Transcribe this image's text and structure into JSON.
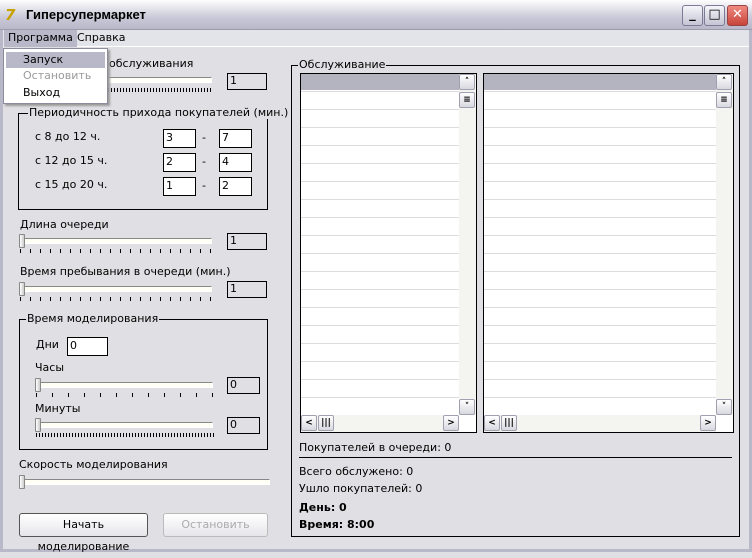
{
  "window": {
    "title": "Гиперсупермаркет",
    "minimize": "_",
    "maximize": "□",
    "close": "✕"
  },
  "menu": {
    "items": [
      "Программа",
      "Справка"
    ],
    "dropdown": [
      {
        "label": "Запуск",
        "state": "highlighted"
      },
      {
        "label": "Остановить",
        "state": "disabled"
      },
      {
        "label": "Выход",
        "state": "normal"
      }
    ]
  },
  "left": {
    "service_label": "обслуживания",
    "service_value": "1",
    "arrival_group": "Периодичность прихода покупателей (мин.)",
    "arrival_rows": [
      {
        "label": "с 8 до 12 ч.",
        "from": "3",
        "to": "7"
      },
      {
        "label": "с 12 до 15 ч.",
        "from": "2",
        "to": "4"
      },
      {
        "label": "с 15 до 20 ч.",
        "from": "1",
        "to": "2"
      }
    ],
    "dash": "-",
    "queue_len_label": "Длина очереди",
    "queue_len_value": "1",
    "queue_time_label": "Время пребывания в очереди (мин.)",
    "queue_time_value": "1",
    "sim_group": "Время моделирования",
    "days_label": "Дни",
    "days_value": "0",
    "hours_label": "Часы",
    "hours_value": "0",
    "minutes_label": "Минуты",
    "minutes_value": "0",
    "speed_label": "Скорость моделирования",
    "start_button": "Начать моделирование",
    "stop_button": "Остановить"
  },
  "right": {
    "group": "Обслуживание",
    "queue_count": "Покупателей в очереди:  0",
    "served": "Всего обслужено: 0",
    "left_customers": "Ушло покупателей: 0",
    "day": "День: 0",
    "time": "Время:  8:00"
  }
}
